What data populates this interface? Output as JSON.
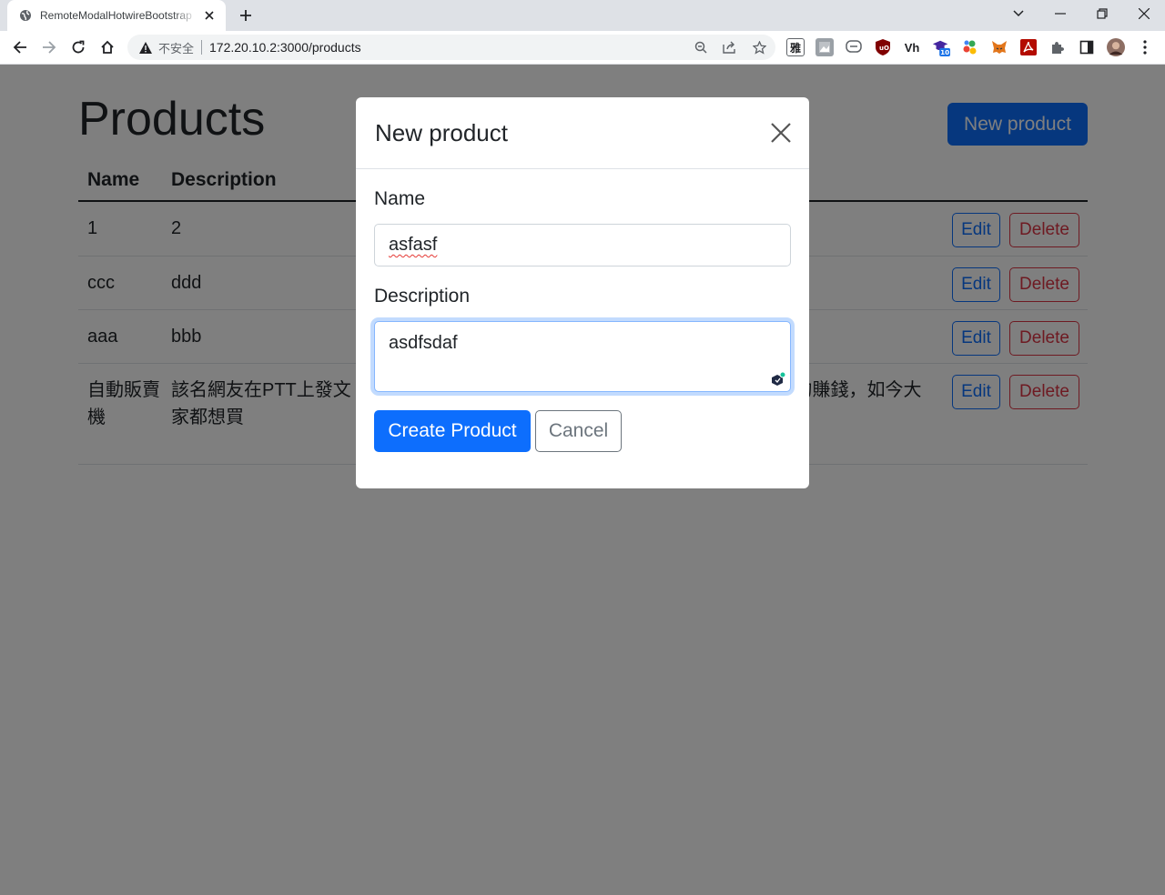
{
  "browser": {
    "tab_title": "RemoteModalHotwireBootstrap",
    "security_label": "不安全",
    "url": "172.20.10.2:3000/products",
    "extension_badge": "10"
  },
  "page": {
    "title": "Products",
    "new_product_button": "New product",
    "columns": [
      "Name",
      "Description"
    ],
    "rows": [
      {
        "name": "1",
        "description": "2"
      },
      {
        "name": "ccc",
        "description": "ddd"
      },
      {
        "name": "aaa",
        "description": "bbb"
      },
      {
        "name": "自動販賣機",
        "description": "該名網友在PTT上發文 ... 任設備工作3個月，大學時期受到祖先 ... 腳踏實地』的賺錢，如今大家都想買"
      }
    ],
    "edit_label": "Edit",
    "delete_label": "Delete"
  },
  "modal": {
    "title": "New product",
    "name_label": "Name",
    "name_value": "asfasf",
    "description_label": "Description",
    "description_value": "asdfsdaf",
    "create_button": "Create Product",
    "cancel_button": "Cancel"
  }
}
